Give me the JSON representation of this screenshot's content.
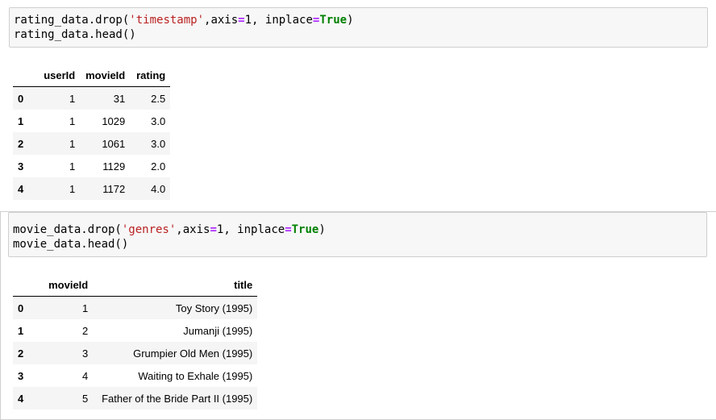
{
  "cells": [
    {
      "code": {
        "line1": {
          "prefix": "rating_data.drop(",
          "str": "'timestamp'",
          "mid1": ",axis",
          "eq1": "=",
          "val1": "1, inplace",
          "eq2": "=",
          "kw": "True",
          "suffix": ")"
        },
        "line2": "rating_data.head()"
      },
      "table": {
        "columns": [
          "userId",
          "movieId",
          "rating"
        ],
        "rows": [
          {
            "index": "0",
            "userId": "1",
            "movieId": "31",
            "rating": "2.5"
          },
          {
            "index": "1",
            "userId": "1",
            "movieId": "1029",
            "rating": "3.0"
          },
          {
            "index": "2",
            "userId": "1",
            "movieId": "1061",
            "rating": "3.0"
          },
          {
            "index": "3",
            "userId": "1",
            "movieId": "1129",
            "rating": "2.0"
          },
          {
            "index": "4",
            "userId": "1",
            "movieId": "1172",
            "rating": "4.0"
          }
        ]
      }
    },
    {
      "code": {
        "line1": {
          "prefix": "movie_data.drop(",
          "str": "'genres'",
          "mid1": ",axis",
          "eq1": "=",
          "val1": "1, inplace",
          "eq2": "=",
          "kw": "True",
          "suffix": ")"
        },
        "line2": "movie_data.head()"
      },
      "table": {
        "columns": [
          "movieId",
          "title"
        ],
        "rows": [
          {
            "index": "0",
            "movieId": "1",
            "title": "Toy Story (1995)"
          },
          {
            "index": "1",
            "movieId": "2",
            "title": "Jumanji (1995)"
          },
          {
            "index": "2",
            "movieId": "3",
            "title": "Grumpier Old Men (1995)"
          },
          {
            "index": "3",
            "movieId": "4",
            "title": "Waiting to Exhale (1995)"
          },
          {
            "index": "4",
            "movieId": "5",
            "title": "Father of the Bride Part II (1995)"
          }
        ]
      }
    }
  ]
}
